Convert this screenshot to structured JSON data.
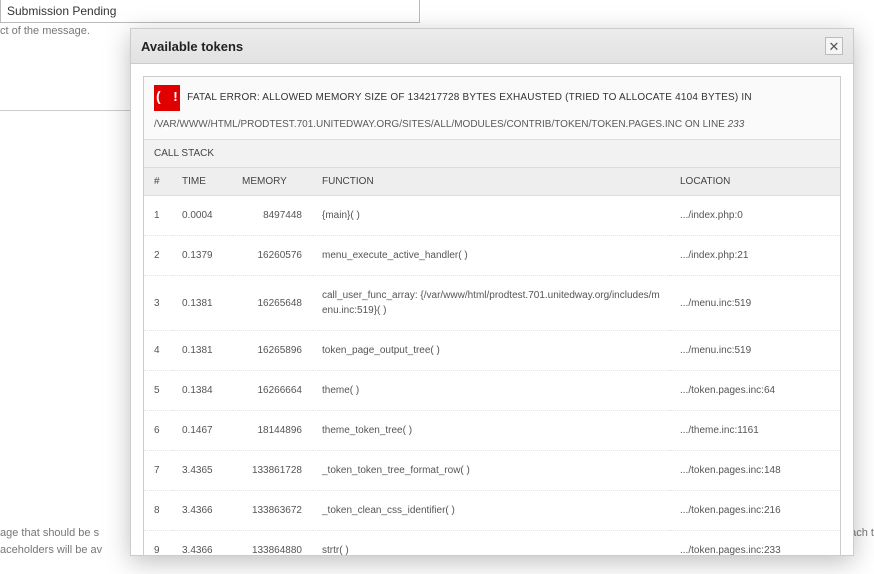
{
  "background": {
    "field_label": "Submission Pending",
    "help_text": "ct of the message.",
    "bottom_help_line1": "age that should be s",
    "bottom_help_line2": "aceholders will be av",
    "bottom_help_tail": "ent each t"
  },
  "dialog": {
    "title": "Available tokens",
    "close_label": "✕"
  },
  "error": {
    "icon_text": "( ! )",
    "message": "FATAL ERROR: ALLOWED MEMORY SIZE OF 134217728 BYTES EXHAUSTED (TRIED TO ALLOCATE 4104 BYTES) IN",
    "path": "/VAR/WWW/HTML/PRODTEST.701.UNITEDWAY.ORG/SITES/ALL/MODULES/CONTRIB/TOKEN/TOKEN.PAGES.INC ON LINE",
    "line": "233",
    "callstack_label": "CALL STACK",
    "columns": {
      "idx": "#",
      "time": "TIME",
      "memory": "MEMORY",
      "function": "FUNCTION",
      "location": "LOCATION"
    },
    "rows": [
      {
        "idx": "1",
        "time": "0.0004",
        "memory": "8497448",
        "func": "{main}( )",
        "loc": ".../index.php:0"
      },
      {
        "idx": "2",
        "time": "0.1379",
        "memory": "16260576",
        "func": "menu_execute_active_handler( )",
        "loc": ".../index.php:21"
      },
      {
        "idx": "3",
        "time": "0.1381",
        "memory": "16265648",
        "func": "call_user_func_array: {/var/www/html/prodtest.701.unitedway.org/includes/menu.inc:519}( )",
        "loc": ".../menu.inc:519"
      },
      {
        "idx": "4",
        "time": "0.1381",
        "memory": "16265896",
        "func": "token_page_output_tree( )",
        "loc": ".../menu.inc:519"
      },
      {
        "idx": "5",
        "time": "0.1384",
        "memory": "16266664",
        "func": "theme( )",
        "loc": ".../token.pages.inc:64"
      },
      {
        "idx": "6",
        "time": "0.1467",
        "memory": "18144896",
        "func": "theme_token_tree( )",
        "loc": ".../theme.inc:1161"
      },
      {
        "idx": "7",
        "time": "3.4365",
        "memory": "133861728",
        "func": "_token_token_tree_format_row( )",
        "loc": ".../token.pages.inc:148"
      },
      {
        "idx": "8",
        "time": "3.4366",
        "memory": "133863672",
        "func": "_token_clean_css_identifier( )",
        "loc": ".../token.pages.inc:216"
      },
      {
        "idx": "9",
        "time": "3.4366",
        "memory": "133864880",
        "func": "strtr( )",
        "loc": ".../token.pages.inc:233"
      }
    ]
  }
}
